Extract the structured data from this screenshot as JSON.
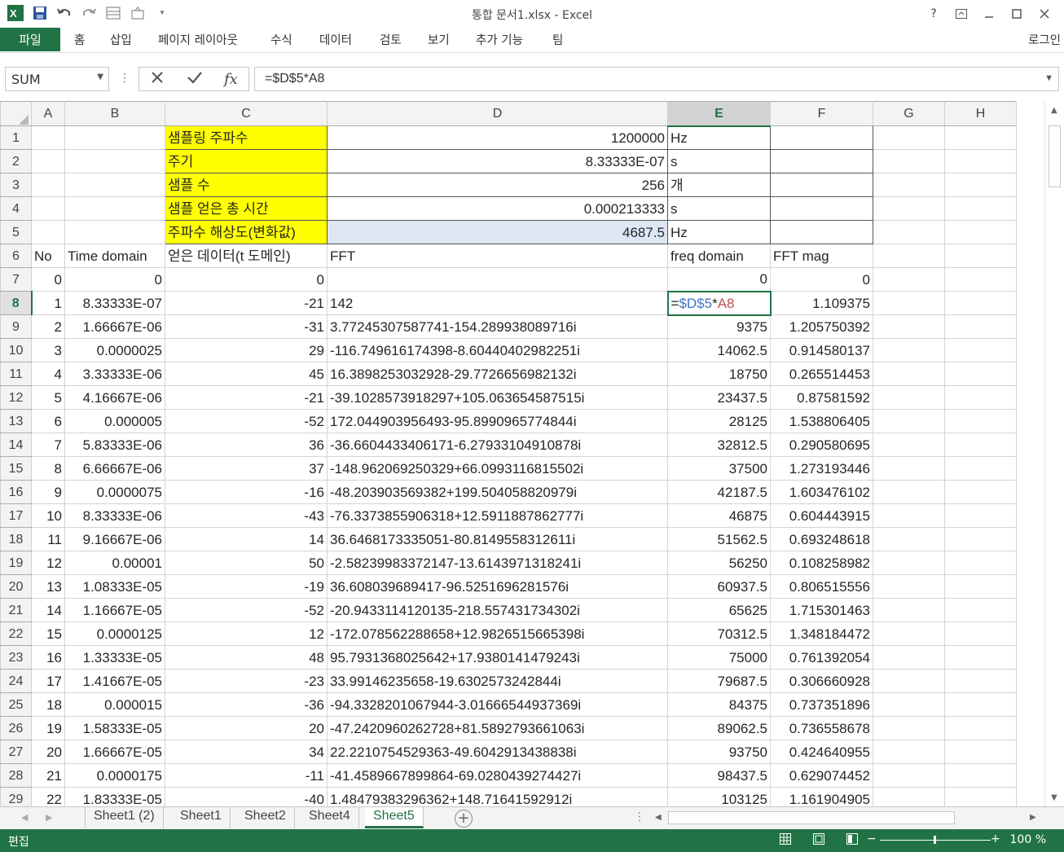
{
  "window": {
    "title": "통합 문서1.xlsx - Excel",
    "help": "?"
  },
  "ribbon": {
    "file": "파일",
    "tabs": [
      "홈",
      "삽입",
      "페이지 레이아웃",
      "수식",
      "데이터",
      "검토",
      "보기",
      "추가 기능",
      "팀"
    ],
    "login": "로그인"
  },
  "formula_bar": {
    "name_box": "SUM",
    "formula": "=$D$5*A8",
    "fx": "fx"
  },
  "columns": [
    "A",
    "B",
    "C",
    "D",
    "E",
    "F",
    "G",
    "H"
  ],
  "rows": [
    {
      "n": "1",
      "c": "샘플링 주파수",
      "d": "1200000",
      "e": "Hz"
    },
    {
      "n": "2",
      "c": "주기",
      "d": "8.33333E-07",
      "e": "s"
    },
    {
      "n": "3",
      "c": "샘플 수",
      "d": "256",
      "e": "개"
    },
    {
      "n": "4",
      "c": "샘플 얻은 총 시간",
      "d": "0.000213333",
      "e": "s"
    },
    {
      "n": "5",
      "c": "주파수 해상도(변화값)",
      "d": "4687.5",
      "e": "Hz"
    },
    {
      "n": "6",
      "a": "No",
      "b": "Time domain",
      "c": "얻은 데이터(t 도메인)",
      "d": "FFT",
      "e": "freq domain",
      "f": "FFT mag"
    },
    {
      "n": "7",
      "a": "0",
      "b": "0",
      "c": "0",
      "d": "",
      "e": "0",
      "f": "0"
    },
    {
      "n": "8",
      "a": "1",
      "b": "8.33333E-07",
      "c": "-21",
      "d": "142",
      "e": "",
      "f": "1.109375"
    },
    {
      "n": "9",
      "a": "2",
      "b": "1.66667E-06",
      "c": "-31",
      "d": "3.77245307587741-154.289938089716i",
      "e": "9375",
      "f": "1.205750392"
    },
    {
      "n": "10",
      "a": "3",
      "b": "0.0000025",
      "c": "29",
      "d": "-116.749616174398-8.60440402982251i",
      "e": "14062.5",
      "f": "0.914580137"
    },
    {
      "n": "11",
      "a": "4",
      "b": "3.33333E-06",
      "c": "45",
      "d": "16.3898253032928-29.7726656982132i",
      "e": "18750",
      "f": "0.265514453"
    },
    {
      "n": "12",
      "a": "5",
      "b": "4.16667E-06",
      "c": "-21",
      "d": "-39.1028573918297+105.063654587515i",
      "e": "23437.5",
      "f": "0.87581592"
    },
    {
      "n": "13",
      "a": "6",
      "b": "0.000005",
      "c": "-52",
      "d": "172.044903956493-95.8990965774844i",
      "e": "28125",
      "f": "1.538806405"
    },
    {
      "n": "14",
      "a": "7",
      "b": "5.83333E-06",
      "c": "36",
      "d": "-36.6604433406171-6.27933104910878i",
      "e": "32812.5",
      "f": "0.290580695"
    },
    {
      "n": "15",
      "a": "8",
      "b": "6.66667E-06",
      "c": "37",
      "d": "-148.962069250329+66.0993116815502i",
      "e": "37500",
      "f": "1.273193446"
    },
    {
      "n": "16",
      "a": "9",
      "b": "0.0000075",
      "c": "-16",
      "d": "-48.203903569382+199.504058820979i",
      "e": "42187.5",
      "f": "1.603476102"
    },
    {
      "n": "17",
      "a": "10",
      "b": "8.33333E-06",
      "c": "-43",
      "d": "-76.3373855906318+12.5911887862777i",
      "e": "46875",
      "f": "0.604443915"
    },
    {
      "n": "18",
      "a": "11",
      "b": "9.16667E-06",
      "c": "14",
      "d": "36.6468173335051-80.8149558312611i",
      "e": "51562.5",
      "f": "0.693248618"
    },
    {
      "n": "19",
      "a": "12",
      "b": "0.00001",
      "c": "50",
      "d": "-2.58239983372147-13.6143971318241i",
      "e": "56250",
      "f": "0.108258982"
    },
    {
      "n": "20",
      "a": "13",
      "b": "1.08333E-05",
      "c": "-19",
      "d": "36.608039689417-96.5251696281576i",
      "e": "60937.5",
      "f": "0.806515556"
    },
    {
      "n": "21",
      "a": "14",
      "b": "1.16667E-05",
      "c": "-52",
      "d": "-20.9433114120135-218.557431734302i",
      "e": "65625",
      "f": "1.715301463"
    },
    {
      "n": "22",
      "a": "15",
      "b": "0.0000125",
      "c": "12",
      "d": "-172.078562288658+12.9826515665398i",
      "e": "70312.5",
      "f": "1.348184472"
    },
    {
      "n": "23",
      "a": "16",
      "b": "1.33333E-05",
      "c": "48",
      "d": "95.7931368025642+17.9380141479243i",
      "e": "75000",
      "f": "0.761392054"
    },
    {
      "n": "24",
      "a": "17",
      "b": "1.41667E-05",
      "c": "-23",
      "d": "33.99146235658-19.6302573242844i",
      "e": "79687.5",
      "f": "0.306660928"
    },
    {
      "n": "25",
      "a": "18",
      "b": "0.000015",
      "c": "-36",
      "d": "-94.3328201067944-3.01666544937369i",
      "e": "84375",
      "f": "0.737351896"
    },
    {
      "n": "26",
      "a": "19",
      "b": "1.58333E-05",
      "c": "20",
      "d": "-47.2420960262728+81.5892793661063i",
      "e": "89062.5",
      "f": "0.736558678"
    },
    {
      "n": "27",
      "a": "20",
      "b": "1.66667E-05",
      "c": "34",
      "d": "22.2210754529363-49.6042913438838i",
      "e": "93750",
      "f": "0.424640955"
    },
    {
      "n": "28",
      "a": "21",
      "b": "0.0000175",
      "c": "-11",
      "d": "-41.4589667899864-69.0280439274427i",
      "e": "98437.5",
      "f": "0.629074452"
    },
    {
      "n": "29",
      "a": "22",
      "b": "1.83333E-05",
      "c": "-40",
      "d": "1.48479383296362+148.71641592912i",
      "e": "103125",
      "f": "1.161904905"
    }
  ],
  "active_cell_formula": {
    "eq": "=",
    "ref1": "$D$5",
    "op": "*",
    "ref2": "A8"
  },
  "sheet_tabs": [
    "Sheet1 (2)",
    "Sheet1",
    "Sheet2",
    "Sheet4",
    "Sheet5"
  ],
  "active_sheet": "Sheet5",
  "status": {
    "mode": "편집",
    "zoom": "100 %"
  },
  "colors": {
    "accent": "#217346",
    "highlight": "#ffff00",
    "ref_blue": "#4472c4",
    "ref_red": "#c0504d"
  }
}
